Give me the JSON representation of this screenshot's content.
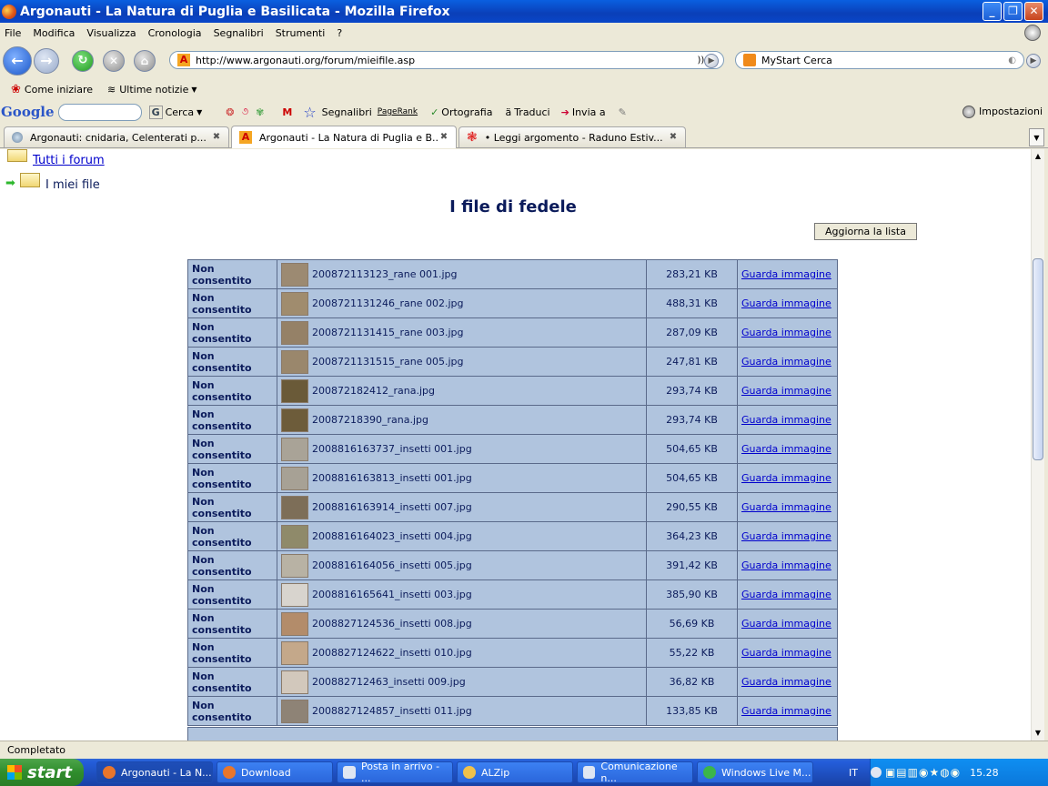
{
  "window": {
    "title": "Argonauti - La Natura di Puglia e Basilicata - Mozilla Firefox"
  },
  "menu": [
    "File",
    "Modifica",
    "Visualizza",
    "Cronologia",
    "Segnalibri",
    "Strumenti",
    "?"
  ],
  "nav": {
    "url": "http://www.argonauti.org/forum/mieifile.asp",
    "search_placeholder": "MyStart Cerca"
  },
  "bookmarks": [
    "Come iniziare",
    "Ultime notizie"
  ],
  "googlebar": {
    "logo": "Google",
    "cerca": "Cerca",
    "segnalibri": "Segnalibri",
    "pagerank": "PageRank",
    "ortografia": "Ortografia",
    "traduci": "Traduci",
    "invia": "Invia a",
    "impostazioni": "Impostazioni"
  },
  "tabs": [
    {
      "label": "Argonauti: cnidaria, Celenterati p..."
    },
    {
      "label": "Argonauti - La Natura di Puglia e B..."
    },
    {
      "label": "• Leggi argomento - Raduno Estiv..."
    }
  ],
  "page": {
    "tutti_forum": "Tutti i forum",
    "miei_file": "I miei file",
    "heading": "I file di fedele",
    "refresh_button": "Aggiorna la lista"
  },
  "files": [
    {
      "perm": "Non consentito",
      "name": "200872113123_rane 001.jpg",
      "size": "283,21 KB",
      "link": "Guarda immagine",
      "color": "#9c8a72"
    },
    {
      "perm": "Non consentito",
      "name": "2008721131246_rane 002.jpg",
      "size": "488,31 KB",
      "link": "Guarda immagine",
      "color": "#a08c6e"
    },
    {
      "perm": "Non consentito",
      "name": "2008721131415_rane 003.jpg",
      "size": "287,09 KB",
      "link": "Guarda immagine",
      "color": "#958167"
    },
    {
      "perm": "Non consentito",
      "name": "2008721131515_rane 005.jpg",
      "size": "247,81 KB",
      "link": "Guarda immagine",
      "color": "#9a876c"
    },
    {
      "perm": "Non consentito",
      "name": "200872182412_rana.jpg",
      "size": "293,74 KB",
      "link": "Guarda immagine",
      "color": "#6a5a38"
    },
    {
      "perm": "Non consentito",
      "name": "20087218390_rana.jpg",
      "size": "293,74 KB",
      "link": "Guarda immagine",
      "color": "#6d5c3a"
    },
    {
      "perm": "Non consentito",
      "name": "2008816163737_insetti 001.jpg",
      "size": "504,65 KB",
      "link": "Guarda immagine",
      "color": "#a9a397"
    },
    {
      "perm": "Non consentito",
      "name": "2008816163813_insetti 001.jpg",
      "size": "504,65 KB",
      "link": "Guarda immagine",
      "color": "#a7a195"
    },
    {
      "perm": "Non consentito",
      "name": "2008816163914_insetti 007.jpg",
      "size": "290,55 KB",
      "link": "Guarda immagine",
      "color": "#7d6e58"
    },
    {
      "perm": "Non consentito",
      "name": "2008816164023_insetti 004.jpg",
      "size": "364,23 KB",
      "link": "Guarda immagine",
      "color": "#8f8a6a"
    },
    {
      "perm": "Non consentito",
      "name": "2008816164056_insetti 005.jpg",
      "size": "391,42 KB",
      "link": "Guarda immagine",
      "color": "#b8b2a4"
    },
    {
      "perm": "Non consentito",
      "name": "2008816165641_insetti 003.jpg",
      "size": "385,90 KB",
      "link": "Guarda immagine",
      "color": "#d8d4ce"
    },
    {
      "perm": "Non consentito",
      "name": "2008827124536_insetti 008.jpg",
      "size": "56,69 KB",
      "link": "Guarda immagine",
      "color": "#b38c6a"
    },
    {
      "perm": "Non consentito",
      "name": "2008827124622_insetti 010.jpg",
      "size": "55,22 KB",
      "link": "Guarda immagine",
      "color": "#c4a88a"
    },
    {
      "perm": "Non consentito",
      "name": "200882712463_insetti 009.jpg",
      "size": "36,82 KB",
      "link": "Guarda immagine",
      "color": "#d2c8bc"
    },
    {
      "perm": "Non consentito",
      "name": "2008827124857_insetti 011.jpg",
      "size": "133,85 KB",
      "link": "Guarda immagine",
      "color": "#8e8376"
    }
  ],
  "status": {
    "text": "Completato"
  },
  "taskbar": {
    "start": "start",
    "items": [
      "Argonauti - La N...",
      "Download",
      "Posta in arrivo - ...",
      "ALZip",
      "Comunicazione n...",
      "Windows Live M..."
    ],
    "lang": "IT",
    "clock": "15.28"
  }
}
